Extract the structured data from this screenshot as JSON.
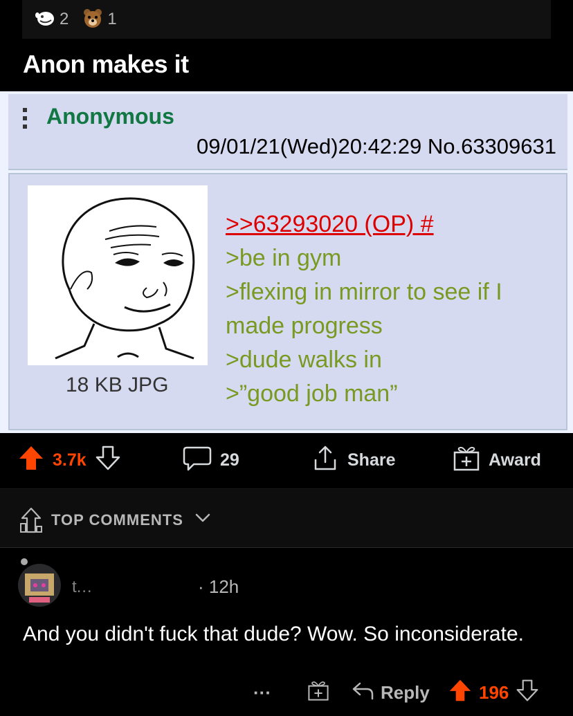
{
  "awards": [
    {
      "icon": "helpful-award-icon",
      "count": "2"
    },
    {
      "icon": "bear-award-icon",
      "count": "1"
    }
  ],
  "post": {
    "title": "Anon makes it"
  },
  "chan_post": {
    "name": "Anonymous",
    "dateline": "09/01/21(Wed)20:42:29 No.63309631",
    "file_info": "18 KB JPG",
    "reply_link": ">>63293020 (OP) #",
    "lines": [
      ">be in gym",
      ">flexing in mirror to see if I",
      "made progress",
      ">dude walks in",
      ">”good job man”"
    ]
  },
  "actions": {
    "upvotes": "3.7k",
    "comments": "29",
    "share": "Share",
    "award": "Award"
  },
  "sort": {
    "label": "TOP COMMENTS"
  },
  "comment": {
    "username": "t…",
    "time": "· 12h",
    "text": "And you didn't fuck that dude? Wow. So inconsiderate.",
    "more": "···",
    "reply": "Reply",
    "votes": "196"
  },
  "colors": {
    "upvote": "#ff4500",
    "greentext": "#789922",
    "name_green": "#117743",
    "reply_red": "#dd0000",
    "chan_bg": "#d6daf0"
  }
}
